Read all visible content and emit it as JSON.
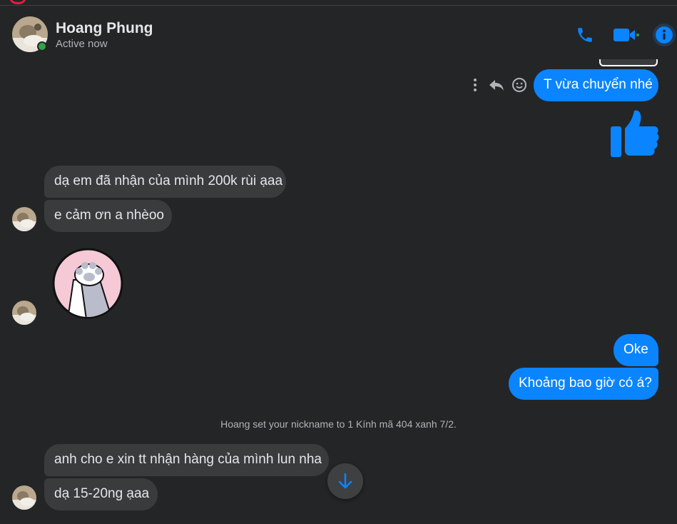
{
  "contact": {
    "name": "Hoang Phung",
    "status": "Active now"
  },
  "header_actions": {
    "call_icon": "phone-icon",
    "video_icon": "video-camera-icon",
    "info_icon": "info-icon"
  },
  "colors": {
    "accent": "#0a84ff",
    "online": "#31a24c",
    "incoming_bubble": "#3a3b3c",
    "background": "#242526"
  },
  "messages": {
    "m1": "T vừa chuyển nhé",
    "m2_sticker": "like-thumbs-up",
    "m3": "dạ em đã nhận của mình 200k rùi ạaa",
    "m4": "e cảm ơn a nhèoo",
    "m5_sticker": "cat-paw-sticker",
    "m6": "Oke",
    "m7": "Khoảng bao giờ có á?",
    "m8": "anh cho e xin tt nhận hàng của mình lun nha",
    "m9": "dạ 15-20ng ạaa"
  },
  "system_message": "Hoang set your nickname to 1 Kính mã 404 xanh 7/2."
}
